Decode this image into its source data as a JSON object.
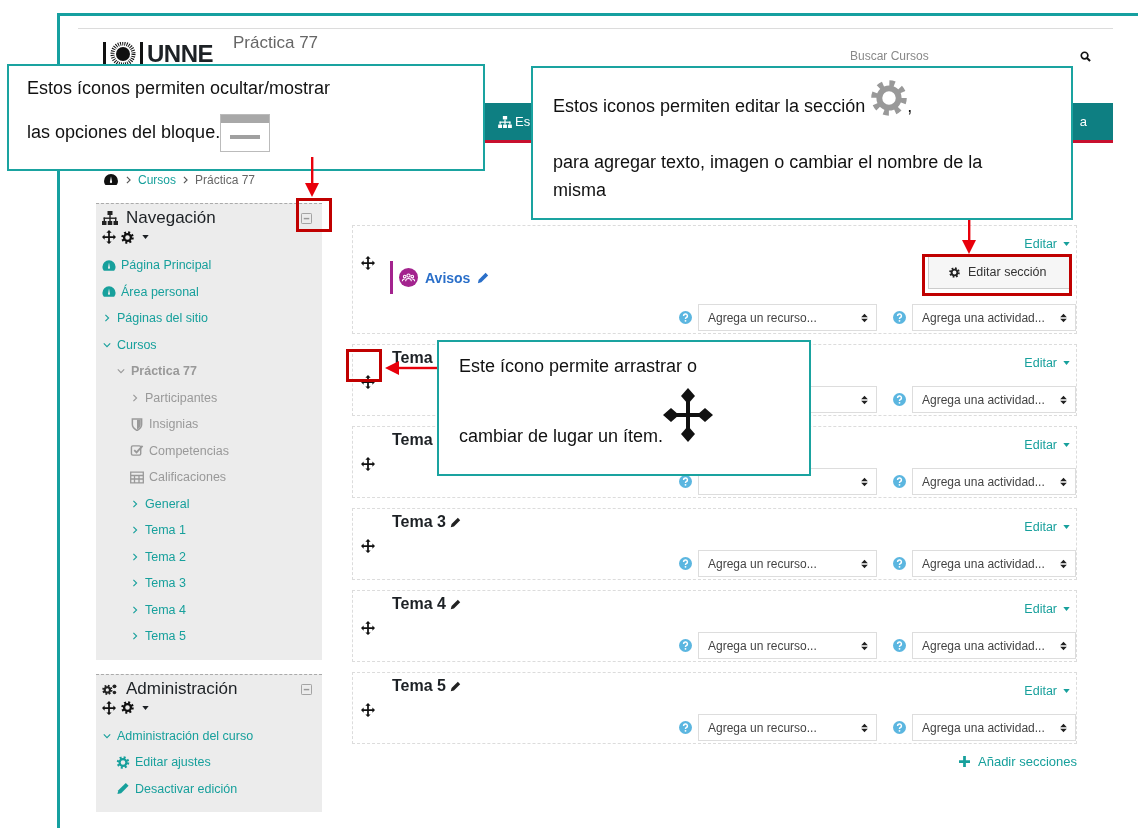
{
  "header": {
    "logo_text": "UNNE",
    "course_title": "Práctica 77",
    "search": {
      "placeholder": "Buscar Cursos"
    }
  },
  "navbar": {
    "items": [
      {
        "label": "Es"
      },
      {
        "label": "a"
      }
    ]
  },
  "breadcrumb": [
    "Cursos",
    "Práctica 77"
  ],
  "blocks": [
    {
      "title": "Navegación",
      "items": [
        {
          "label": "Página Principal",
          "kind": "dashboard",
          "muted": false
        },
        {
          "label": "Área personal",
          "kind": "dashboard",
          "muted": false
        },
        {
          "label": "Páginas del sitio",
          "kind": "branch",
          "expanded": false,
          "muted": false
        },
        {
          "label": "Cursos",
          "kind": "branch",
          "expanded": true,
          "muted": false,
          "children": [
            {
              "label": "Práctica 77",
              "kind": "branch",
              "expanded": true,
              "muted": true,
              "children": [
                {
                  "label": "Participantes",
                  "kind": "branch",
                  "expanded": false,
                  "muted": true
                },
                {
                  "label": "Insignias",
                  "kind": "badge",
                  "muted": true
                },
                {
                  "label": "Competencias",
                  "kind": "competency",
                  "muted": true
                },
                {
                  "label": "Calificaciones",
                  "kind": "grades",
                  "muted": true
                },
                {
                  "label": "General",
                  "kind": "branch",
                  "expanded": false,
                  "muted": false
                },
                {
                  "label": "Tema 1",
                  "kind": "branch",
                  "expanded": false,
                  "muted": false
                },
                {
                  "label": "Tema 2",
                  "kind": "branch",
                  "expanded": false,
                  "muted": false
                },
                {
                  "label": "Tema 3",
                  "kind": "branch",
                  "expanded": false,
                  "muted": false
                },
                {
                  "label": "Tema 4",
                  "kind": "branch",
                  "expanded": false,
                  "muted": false
                },
                {
                  "label": "Tema 5",
                  "kind": "branch",
                  "expanded": false,
                  "muted": false
                }
              ]
            }
          ]
        }
      ]
    },
    {
      "title": "Administración",
      "items": [
        {
          "label": "Administración del curso",
          "kind": "branch",
          "expanded": true,
          "muted": false,
          "children": [
            {
              "label": "Editar ajustes",
              "kind": "settings",
              "muted": false
            },
            {
              "label": "Desactivar edición",
              "kind": "edit",
              "muted": false
            }
          ]
        }
      ]
    }
  ],
  "sections": [
    {
      "kind": "general",
      "activities": [
        {
          "kind": "forum",
          "name": "Avisos"
        }
      ],
      "edit": {
        "label": "Editar",
        "expanded": true,
        "items": [
          "Editar sección"
        ]
      },
      "resource_help": true,
      "resource_placeholder": "Agrega un recurso...",
      "activity_placeholder": "Agrega una actividad..."
    },
    {
      "kind": "topic",
      "title": "Tema",
      "edit": {
        "label": "Editar"
      },
      "activity_placeholder": "Agrega una actividad..."
    },
    {
      "kind": "topic",
      "title": "Tema",
      "edit": {
        "label": "Editar"
      },
      "resource_help": true,
      "activity_placeholder": "Agrega una actividad..."
    },
    {
      "kind": "topic",
      "title": "Tema 3",
      "pencil": true,
      "edit": {
        "label": "Editar"
      },
      "resource_help": true,
      "resource_placeholder": "Agrega un recurso...",
      "activity_placeholder": "Agrega una actividad..."
    },
    {
      "kind": "topic",
      "title": "Tema 4",
      "pencil": true,
      "edit": {
        "label": "Editar"
      },
      "resource_help": true,
      "resource_placeholder": "Agrega un recurso...",
      "activity_placeholder": "Agrega una actividad..."
    },
    {
      "kind": "topic",
      "title": "Tema 5",
      "pencil": true,
      "edit": {
        "label": "Editar"
      },
      "resource_help": true,
      "resource_placeholder": "Agrega un recurso...",
      "activity_placeholder": "Agrega una actividad..."
    }
  ],
  "add_sections": "Añadir secciones",
  "callouts": [
    {
      "paragraphs": [
        {
          "parts": [
            {
              "kind": "text",
              "text": "Estos íconos permiten ocultar/mostrar"
            }
          ]
        },
        {
          "parts": [
            {
              "kind": "text",
              "text": "las opciones del bloque."
            },
            {
              "kind": "minimize"
            }
          ]
        }
      ]
    },
    {
      "paragraphs": [
        {
          "parts": [
            {
              "kind": "text",
              "text": "Estos iconos permiten editar la sección"
            },
            {
              "kind": "gear"
            },
            {
              "kind": "text",
              "text": ","
            }
          ]
        },
        {
          "parts": [
            {
              "kind": "text",
              "text": "para agregar texto, imagen o cambiar el nombre de la misma"
            }
          ]
        }
      ]
    },
    {
      "paragraphs": [
        {
          "parts": [
            {
              "kind": "text",
              "text": "Este ícono permite arrastrar o"
            }
          ]
        },
        {
          "parts": [
            {
              "kind": "text",
              "text": "cambiar de lugar un ítem."
            },
            {
              "kind": "move"
            }
          ]
        }
      ]
    }
  ]
}
